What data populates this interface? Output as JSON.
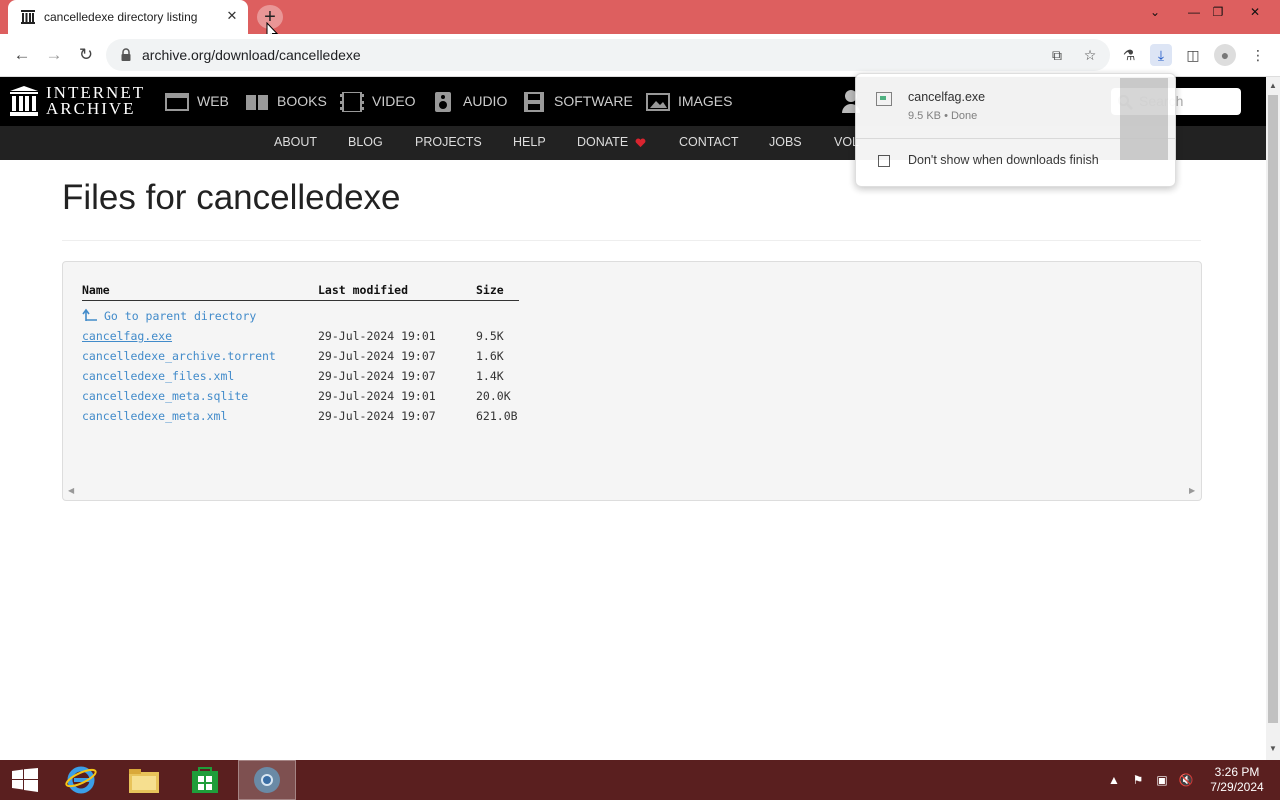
{
  "browser": {
    "tab_title": "cancelledexe directory listing",
    "tab_close": "✕",
    "new_tab": "+",
    "url": "archive.org/download/cancelledexe",
    "window_controls": {
      "dropdown": "⌄",
      "minimize": "—",
      "restore": "❐",
      "close": "✕"
    },
    "icons": [
      "back-icon",
      "forward-icon",
      "reload-icon",
      "lock-icon",
      "share-icon",
      "bookmark-star-icon",
      "extension-icon",
      "download-icon",
      "sidepanel-icon",
      "profile-icon",
      "menu-icon"
    ]
  },
  "ia_header": {
    "logo_line1": "INTERNET",
    "logo_line2": "ARCHIVE",
    "media": [
      "WEB",
      "BOOKS",
      "VIDEO",
      "AUDIO",
      "SOFTWARE",
      "IMAGES"
    ],
    "sub_links": [
      "ABOUT",
      "BLOG",
      "PROJECTS",
      "HELP",
      "DONATE",
      "CONTACT",
      "JOBS",
      "VOL"
    ],
    "search_placeholder": "Search",
    "donate_heart_color": "#d9242f"
  },
  "main": {
    "title": "Files for cancelledexe",
    "table": {
      "headers": {
        "name": "Name",
        "modified": "Last modified",
        "size": "Size"
      },
      "parent_link": "Go to parent directory",
      "rows": [
        {
          "name": "cancelfag.exe",
          "modified": "29-Jul-2024 19:01",
          "size": "9.5K"
        },
        {
          "name": "cancelledexe_archive.torrent",
          "modified": "29-Jul-2024 19:07",
          "size": "1.6K"
        },
        {
          "name": "cancelledexe_files.xml",
          "modified": "29-Jul-2024 19:07",
          "size": "1.4K"
        },
        {
          "name": "cancelledexe_meta.sqlite",
          "modified": "29-Jul-2024 19:01",
          "size": "20.0K"
        },
        {
          "name": "cancelledexe_meta.xml",
          "modified": "29-Jul-2024 19:07",
          "size": "621.0B"
        }
      ]
    }
  },
  "download_popup": {
    "file_name": "cancelfag.exe",
    "status": "9.5 KB • Done",
    "checkbox_label": "Don't show when downloads finish"
  },
  "taskbar": {
    "apps": [
      "start-button",
      "internet-explorer",
      "file-explorer",
      "store",
      "chrome"
    ],
    "time": "3:26 PM",
    "date": "7/29/2024",
    "tray": [
      "show-hidden-icon",
      "flag-icon",
      "network-icon",
      "volume-muted-icon"
    ]
  },
  "colors": {
    "titlebar": "#dd5f5f",
    "link": "#428bca",
    "taskbar": "#5a1f1f"
  }
}
